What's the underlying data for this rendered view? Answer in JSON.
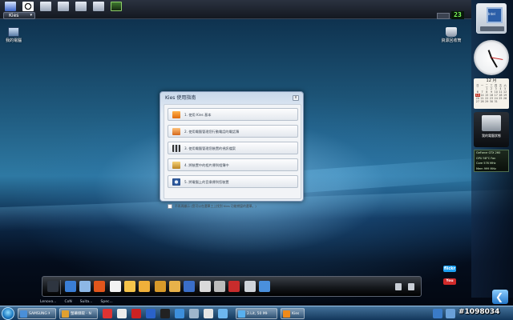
{
  "top_bar": {
    "tab_label": "Kies",
    "counter": "23",
    "icons": [
      "windows-logo-icon",
      "media-player-icon",
      "document-icon",
      "drive-icon",
      "folder-icon",
      "notes-icon",
      "gpu-monitor-icon"
    ]
  },
  "desktop": {
    "computer_label": "我的電腦",
    "recycle_label": "資源回收筒"
  },
  "gadgets": {
    "cpu_chip": "Intel",
    "calendar_header": "12 月",
    "calendar_days": [
      "日",
      "一",
      "二",
      "三",
      "四",
      "五",
      "六",
      "",
      "",
      "1",
      "2",
      "3",
      "4",
      "5",
      "6",
      "7",
      "8",
      "9",
      "10",
      "11",
      "12",
      "13",
      "14",
      "15",
      "16",
      "17",
      "18",
      "19",
      "20",
      "21",
      "22",
      "23",
      "24",
      "25",
      "26",
      "27",
      "28",
      "29",
      "30",
      "31",
      "",
      "",
      ""
    ],
    "printer_label": "我的電腦狀態",
    "gpu_lines": [
      "GeForce GTX 260",
      "GPU 58°C  Fan",
      "Core 576 MHz",
      "Mem 999 MHz"
    ]
  },
  "dialog": {
    "title": "Kies 使用指南",
    "close": "x",
    "items": [
      {
        "icon": "kies-icon",
        "label": "1. 使用 Kies 基本"
      },
      {
        "icon": "phone-contacts-icon",
        "label": "2. 使用電腦管理您行動電話的電話簿"
      },
      {
        "icon": "film-icon",
        "label": "3. 使用電腦管理您裝置的視訊檔案"
      },
      {
        "icon": "photo-folder-icon",
        "label": "4. 將裝置中的相片傳到相簿中"
      },
      {
        "icon": "sync-icon",
        "label": "5. 將電腦上的音樂傳到您裝置"
      }
    ],
    "checkbox_label": "不再再顯示 (您可以在選單工上找到 Kies 功能視窗的選單。)"
  },
  "dock": {
    "icons": [
      "pen-icon",
      "windows-flag-icon",
      "sailboat-icon",
      "phone-icon",
      "calendar-icon",
      "mail-icon",
      "notes-icon",
      "folder-icon",
      "photos-icon",
      "media-icon",
      "film-reel-icon",
      "gamepad-icon",
      "toolbox-icon",
      "settings-icon",
      "globe-icon"
    ],
    "tray_icons": [
      "trash-icon",
      "gear-icon"
    ]
  },
  "widgets": {
    "flickr": "flickr",
    "youtube": "You"
  },
  "quick_launch_labels": [
    "Lenovo...",
    "CoN",
    "Suita...",
    "Spec..."
  ],
  "taskbar": {
    "buttons": [
      {
        "label": "SAMSUNG Kies..."
      },
      {
        "label": "螢幕擷取 - Nicoli..."
      },
      {
        "label": "2.Lit, 50 MHz S..."
      },
      {
        "label": "Kies"
      }
    ],
    "watermark": "#1098034"
  },
  "colors": {
    "accent": "#1b78c0",
    "dialog_border": "#7d94b3",
    "counter_green": "#7cff5a"
  }
}
